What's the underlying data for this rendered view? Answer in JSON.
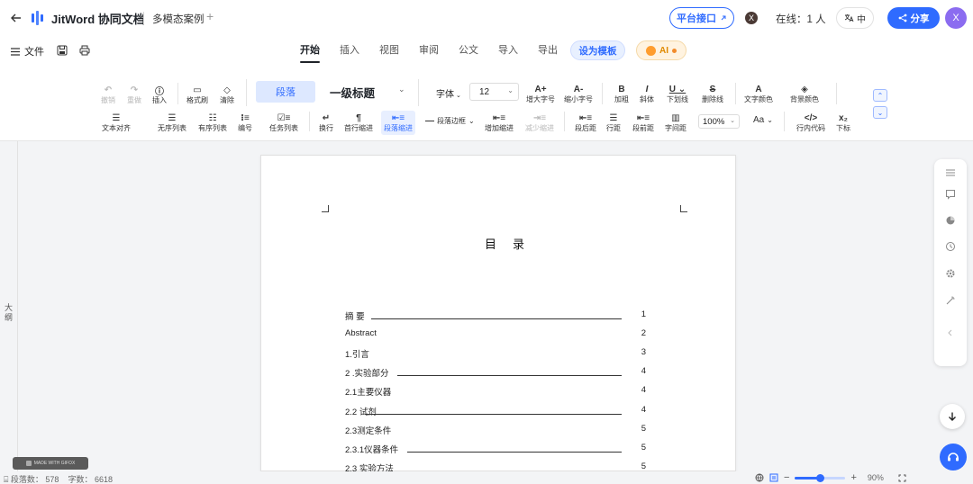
{
  "header": {
    "app_name": "JitWord 协同文档",
    "doc_title": "多模态案例",
    "new_tab": "+",
    "platform_button": "平台接口",
    "collaborator_initial": "X",
    "online_label": "在线：1 人",
    "lang_label": "中",
    "share_label": "分享",
    "user_initial": "X",
    "accent_color": "#2f6bff"
  },
  "menubar": {
    "file_label": "文件",
    "tabs": [
      "开始",
      "插入",
      "视图",
      "审阅",
      "公文",
      "导入",
      "导出"
    ],
    "active_tab": "开始",
    "template_button": "设为模板",
    "ai_label": "AI"
  },
  "toolbar": {
    "undo": "撤销",
    "redo": "重做",
    "insert": "插入",
    "format_painter": "格式刷",
    "clear": "清除",
    "para_style": "段落",
    "heading_style": "一级标题",
    "font_label": "字体",
    "font_size": "12",
    "grow_font": "增大字号",
    "shrink_font": "缩小字号",
    "bold": "加粗",
    "italic": "斜体",
    "underline": "下划线",
    "strike": "删除线",
    "text_color": "文字颜色",
    "bg_color": "背景颜色",
    "align": "文本对齐",
    "bullet_list": "无序列表",
    "ordered_list": "有序列表",
    "numbering": "编号",
    "task_list": "任务列表",
    "line_break": "换行",
    "first_indent": "首行缩进",
    "para_indent": "段落缩进",
    "para_border": "段落边框",
    "inc_indent": "增加缩进",
    "dec_indent": "减少缩进",
    "para_before": "段后距",
    "line_spacing": "行距",
    "para_after": "段前距",
    "char_spacing": "字间距",
    "zoom": "100%",
    "case_label": "Aa",
    "inline_code": "行内代码",
    "subscript": "下标"
  },
  "sidebar": {
    "outline_label": "大纲"
  },
  "document": {
    "toc_title": "目录",
    "toc": [
      {
        "title": "摘 要",
        "page": "1",
        "leader": true
      },
      {
        "title": "Abstract",
        "page": "2",
        "leader": false
      },
      {
        "title": "1.引言",
        "page": "3",
        "leader": false
      },
      {
        "title": "2 .实验部分",
        "page": "4",
        "leader": true
      },
      {
        "title": "2.1主要仪器",
        "page": "4",
        "leader": false
      },
      {
        "title": "2.2 试剂",
        "page": "4",
        "leader": true
      },
      {
        "title": "2.3测定条件",
        "page": "5",
        "leader": false
      },
      {
        "title": "2.3.1仪器条件",
        "page": "5",
        "leader": true
      },
      {
        "title": "2.3 实验方法",
        "page": "5",
        "leader": false
      }
    ]
  },
  "statusbar": {
    "para_count": "段落数： 578",
    "word_count": "字数： 6618",
    "zoom": "90%",
    "zoom_fraction": 0.5
  },
  "watermark": "MADE WITH GIFOX"
}
